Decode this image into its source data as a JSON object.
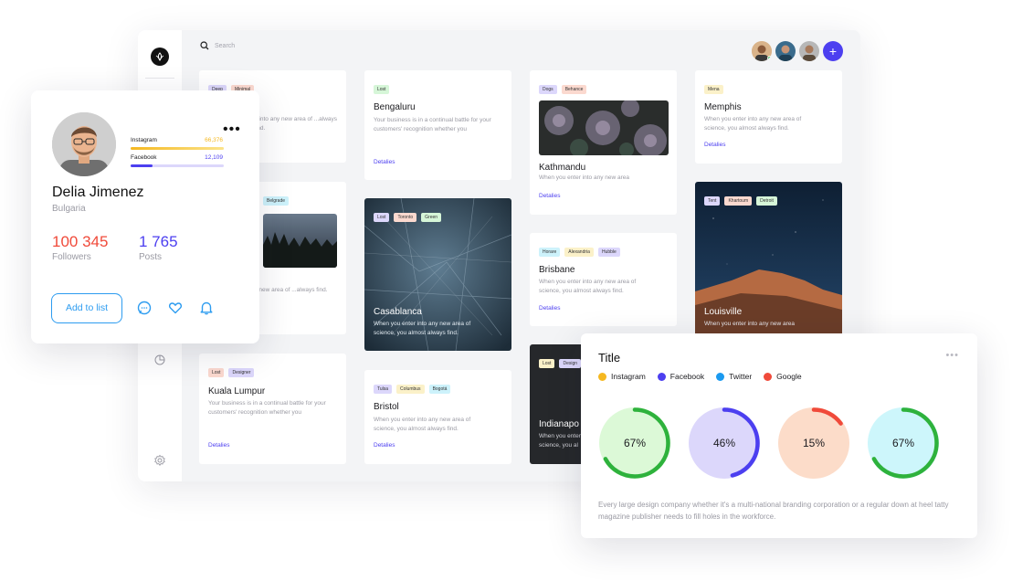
{
  "dashboard": {
    "search": {
      "placeholder": "Search"
    },
    "colors": {
      "accent": "#4c3ff0",
      "link": "#4c3ff0"
    },
    "cards": [
      {
        "tags": [
          "Deep",
          "Minimal"
        ],
        "desc": "...into any new area of ...always find."
      },
      {
        "tags": [
          "Lost"
        ],
        "title": "Bengaluru",
        "desc": "Your business is in a continual battle for your customers' recognition whether you",
        "link": "Detalies"
      },
      {
        "tags": [
          "Dogs",
          "Behance"
        ],
        "title": "Kathmandu",
        "desc": "When you enter into any new area",
        "link": "Detalies"
      },
      {
        "tags": [
          "Mena"
        ],
        "title": "Memphis",
        "desc": "When you enter into any new area of science, you almost always find.",
        "link": "Detalies"
      },
      {
        "tags": [
          "Belgrade"
        ],
        "desc": "...new area of ...always find."
      },
      {
        "tags": [
          "Lost",
          "Toronto",
          "Green"
        ],
        "title": "Casablanca",
        "desc": "When you enter into any new area of science, you almost always find."
      },
      {
        "tags": [
          "Horare",
          "Alexandria",
          "Hubble"
        ],
        "title": "Brisbane",
        "desc": "When you enter into any new area of science, you almost always find.",
        "link": "Detalies"
      },
      {
        "tags": [
          "Tent",
          "Khartoum",
          "Detroit"
        ],
        "title": "Louisville",
        "desc": "When you enter into any new area"
      },
      {
        "tags": [
          "Lost",
          "Designer"
        ],
        "title": "Kuala Lumpur",
        "desc": "Your business is in a continual battle for your customers' recognition whether you",
        "link": "Detalies"
      },
      {
        "tags": [
          "Tulsa",
          "Columbus",
          "Bogotá"
        ],
        "title": "Bristol",
        "desc": "When you enter into any new area of science, you almost always find.",
        "link": "Detalies"
      },
      {
        "tags": [
          "Lost",
          "Design"
        ],
        "title": "Indianapo",
        "desc": "When you enter into any new area of science, you al"
      }
    ]
  },
  "profile": {
    "name": "Delia Jimenez",
    "country": "Bulgaria",
    "social": [
      {
        "label": "Instagram",
        "value": "66,376",
        "progress": 1.0,
        "color": "#f5b820"
      },
      {
        "label": "Facebook",
        "value": "12,109",
        "progress": 0.24,
        "color": "#4c3ff0"
      }
    ],
    "followers": {
      "value": "100 345",
      "label": "Followers",
      "color": "#f04a3a"
    },
    "posts": {
      "value": "1 765",
      "label": "Posts",
      "color": "#4c3ff0"
    },
    "add_label": "Add to list",
    "more": "•••"
  },
  "chart_card": {
    "title": "Title",
    "more": "•••",
    "description": "Every large design company whether it's a multi-national branding corporation or a regular down at heel tatty magazine publisher needs to fill holes in the workforce."
  },
  "chart_data": {
    "type": "donut",
    "title": "Title",
    "legend_position": "top-left",
    "series": [
      {
        "name": "Instagram",
        "value": 67,
        "label": "67%",
        "color": "#2eb23c",
        "legend_color": "#f5b820",
        "bg": "#dcf9d7"
      },
      {
        "name": "Facebook",
        "value": 46,
        "label": "46%",
        "color": "#4c3ff0",
        "legend_color": "#4c3ff0",
        "bg": "#dcd7fb"
      },
      {
        "name": "Twitter",
        "value": 15,
        "label": "15%",
        "color": "#f04a3a",
        "legend_color": "#1b9af0",
        "bg": "#fcdcc9"
      },
      {
        "name": "Google",
        "value": 67,
        "label": "67%",
        "color": "#2eb23c",
        "legend_color": "#f04a3a",
        "bg": "#cdf6fb"
      }
    ]
  }
}
